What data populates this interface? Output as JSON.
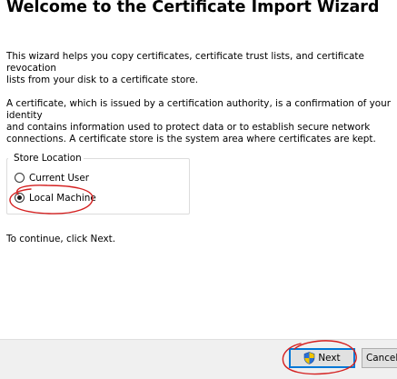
{
  "wizard": {
    "title": "Welcome to the Certificate Import Wizard",
    "intro": "This wizard helps you copy certificates, certificate trust lists, and certificate revocation\nlists from your disk to a certificate store.",
    "description": "A certificate, which is issued by a certification authority, is a confirmation of your identity\nand contains information used to protect data or to establish secure network\nconnections. A certificate store is the system area where certificates are kept.",
    "continue_text": "To continue, click Next."
  },
  "store_location": {
    "label": "Store Location",
    "options": [
      {
        "label": "Current User",
        "selected": false
      },
      {
        "label": "Local Machine",
        "selected": true
      }
    ]
  },
  "buttons": {
    "next_label": "Next",
    "cancel_label": "Cancel"
  },
  "colors": {
    "annotation": "#d42020",
    "shield_blue": "#2a6fd6",
    "shield_yellow": "#f2c400",
    "default_button_border": "#0078d7",
    "footer_background": "#f0f0f0"
  }
}
